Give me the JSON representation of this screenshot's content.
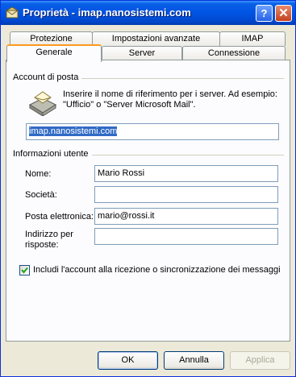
{
  "window": {
    "title": "Proprietà - imap.nanosistemi.com",
    "help_label": "?",
    "close_label": "✕"
  },
  "tabs": {
    "row1": [
      {
        "label": "Protezione"
      },
      {
        "label": "Impostazioni avanzate"
      },
      {
        "label": "IMAP"
      }
    ],
    "row2": [
      {
        "label": "Generale",
        "active": true
      },
      {
        "label": "Server"
      },
      {
        "label": "Connessione"
      }
    ]
  },
  "account": {
    "group_label": "Account di posta",
    "description": "Inserire il nome di riferimento per i server. Ad esempio: \"Ufficio\" o \"Server Microsoft Mail\".",
    "name_value": "imap.nanosistemi.com"
  },
  "user_info": {
    "group_label": "Informazioni utente",
    "fields": [
      {
        "label": "Nome:",
        "value": "Mario Rossi"
      },
      {
        "label": "Società:",
        "value": ""
      },
      {
        "label": "Posta elettronica:",
        "value": "mario@rossi.it"
      },
      {
        "label": "Indirizzo per risposte:",
        "value": ""
      }
    ]
  },
  "include_check": {
    "label": "Includi l'account alla ricezione o sincronizzazione dei messaggi",
    "checked": true
  },
  "buttons": {
    "ok": "OK",
    "cancel": "Annulla",
    "apply": "Applica"
  },
  "colors": {
    "titlebar": "#0054e3",
    "tab_highlight": "#ff9a1c",
    "checkmark": "#21a121"
  }
}
